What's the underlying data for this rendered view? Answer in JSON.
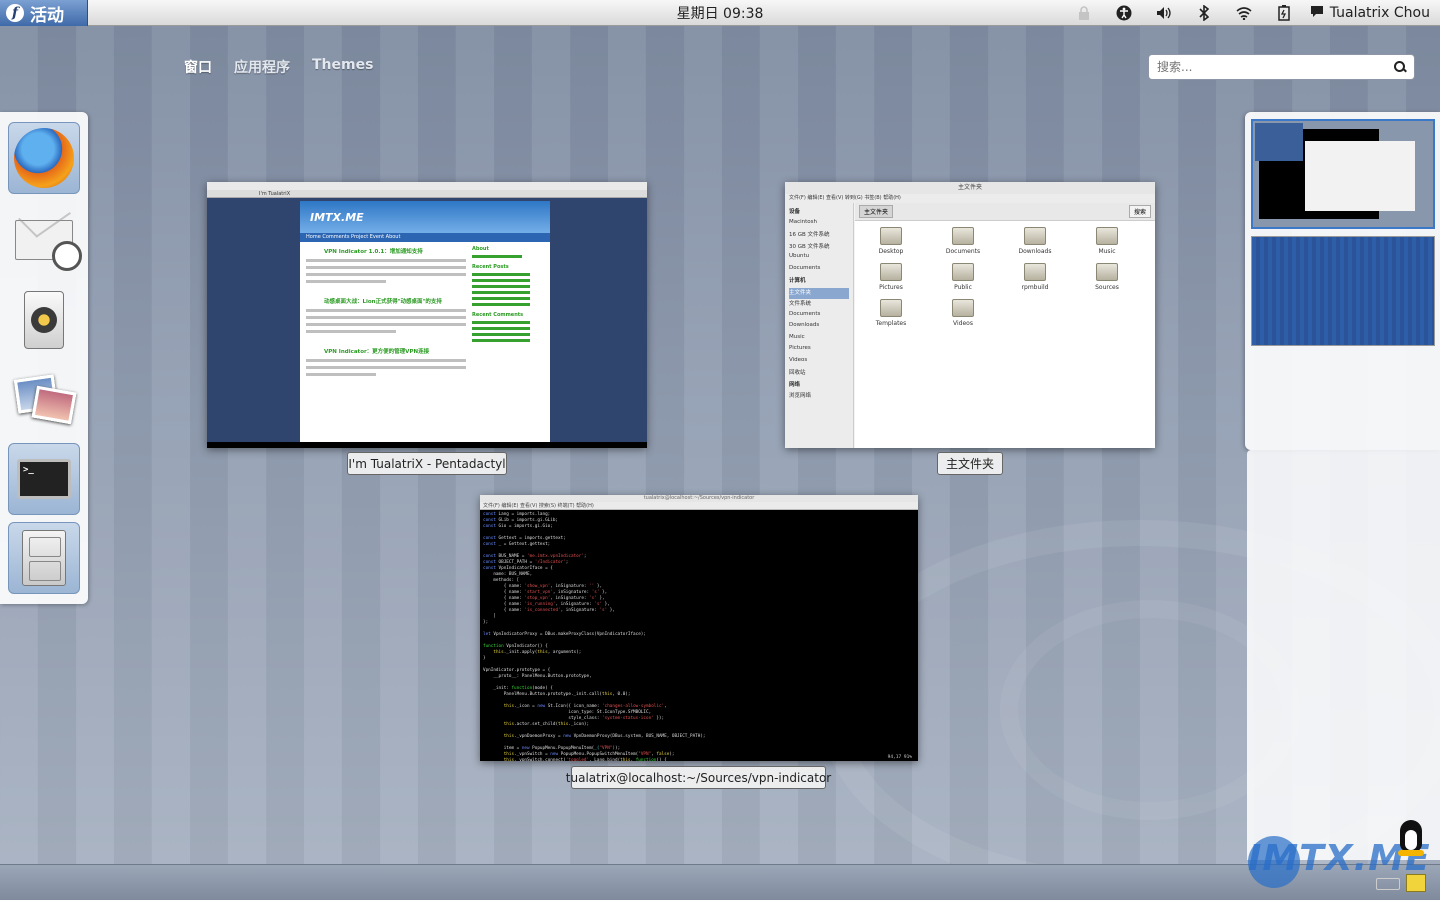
{
  "top_panel": {
    "activities_label": "活动",
    "clock": "星期日 09:38",
    "user_name": "Tualatrix Chou"
  },
  "view_tabs": [
    "窗口",
    "应用程序",
    "Themes"
  ],
  "search": {
    "placeholder": "搜索..."
  },
  "dash": [
    "firefox",
    "evolution-mail",
    "rhythmbox",
    "shotwell",
    "terminal",
    "files"
  ],
  "windows": {
    "browser": {
      "caption": "I'm TualatriX - Pentadactyl",
      "tab_label": "I'm TualatriX",
      "site_logo": "IMTX.ME",
      "nav": "Home  Comments  Project  Event  About",
      "post1": "VPN Indicator 1.0.1：增加通知支持",
      "post2": "动感桌面大战：Lion正式获得\"动感桌面\"的支持",
      "post3": "VPN Indicator：更方便的管理VPN连接",
      "sidebar_about": "About",
      "sidebar_recent": "Recent Posts",
      "sidebar_comments": "Recent Comments"
    },
    "files": {
      "caption": "主文件夹",
      "title": "主文件夹",
      "menu": "文件(F)  编辑(E)  查看(V)  转到(G)  书签(B)  帮助(H)",
      "location": "主文件夹",
      "search_btn": "搜索",
      "sidebar": [
        "设备",
        "Macintosh",
        "16 GB 文件系统",
        "30 GB 文件系统",
        "Ubuntu",
        "Documents",
        "计算机",
        "主文件夹",
        "文件系统",
        "Documents",
        "Downloads",
        "Music",
        "Pictures",
        "Videos",
        "回收站",
        "网络",
        "浏览网络"
      ],
      "folders": [
        "Desktop",
        "Documents",
        "Downloads",
        "Music",
        "Pictures",
        "Public",
        "rpmbuild",
        "Sources",
        "Templates",
        "Videos"
      ]
    },
    "terminal": {
      "caption": "tualatrix@localhost:~/Sources/vpn-indicator",
      "menu": "文件(F)  编辑(E)  查看(V)  搜索(S)  终端(T)  帮助(H)",
      "status": "94,17          91%"
    }
  },
  "watermark": "IMTX.ME"
}
